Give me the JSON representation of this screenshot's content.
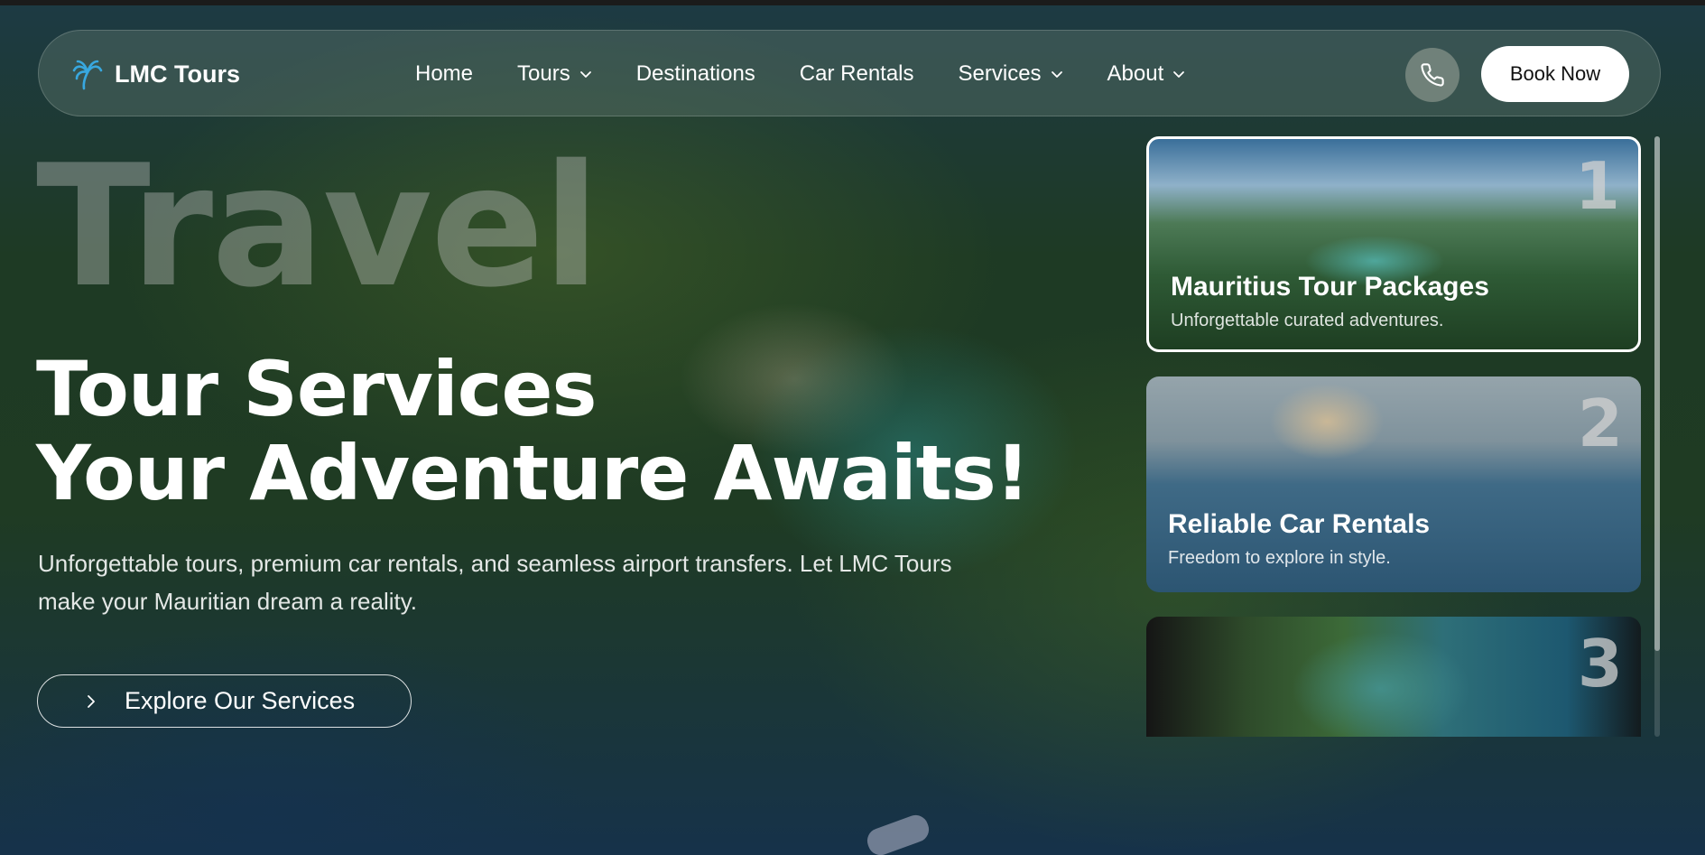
{
  "navbar": {
    "brand": "LMC Tours",
    "brand_icon": "palm-tree-icon",
    "links": [
      {
        "label": "Home",
        "dropdown": false
      },
      {
        "label": "Tours",
        "dropdown": true
      },
      {
        "label": "Destinations",
        "dropdown": false
      },
      {
        "label": "Car Rentals",
        "dropdown": false
      },
      {
        "label": "Services",
        "dropdown": true
      },
      {
        "label": "About",
        "dropdown": true
      }
    ],
    "phone_icon": "phone-icon",
    "cta": "Book Now",
    "accent": "#38a8e0"
  },
  "hero": {
    "background_word": "Travel",
    "headline_line1": "Tour Services",
    "headline_line2": "Your Adventure Awaits!",
    "subtext": "Unforgettable tours, premium car rentals, and seamless airport transfers. Let LMC Tours make your Mauritian dream a reality.",
    "button": "Explore Our Services"
  },
  "cards": [
    {
      "number": "1",
      "title": "Mauritius Tour Packages",
      "subtitle": "Unforgettable curated adventures.",
      "active": true
    },
    {
      "number": "2",
      "title": "Reliable Car Rentals",
      "subtitle": "Freedom to explore in style.",
      "active": false
    },
    {
      "number": "3",
      "title": "",
      "subtitle": "",
      "active": false
    }
  ]
}
